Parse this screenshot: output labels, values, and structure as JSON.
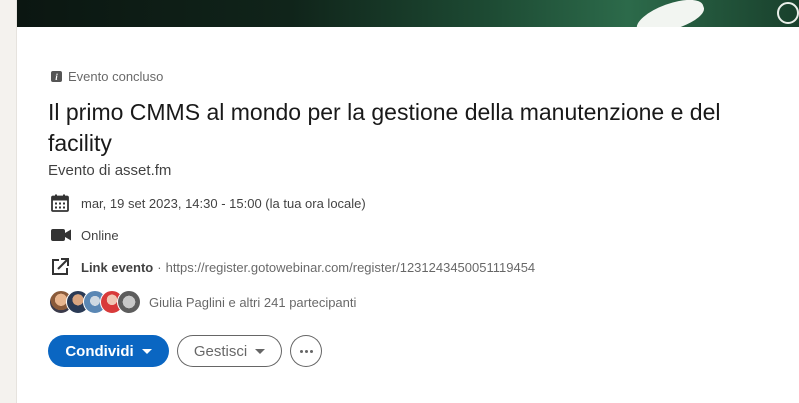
{
  "event": {
    "status": "Evento concluso",
    "title": "Il primo CMMS al mondo per la gestione della manutenzione e del facility",
    "organizer_prefix": "Evento di",
    "organizer_name": "asset.fm",
    "date": "mar, 19 set 2023, 14:30 - 15:00 (la tua ora locale)",
    "location": "Online",
    "link_label": "Link evento",
    "link_separator": "·",
    "link_url": "https://register.gotowebinar.com/register/1231243450051119454",
    "attendees_text": "Giulia Paglini e altri 241 partecipanti"
  },
  "actions": {
    "share_label": "Condividi",
    "manage_label": "Gestisci"
  },
  "icons": {
    "status": "info-icon",
    "date": "calendar-icon",
    "location": "video-camera-icon",
    "link": "external-link-icon",
    "more": "more-horizontal-icon"
  },
  "colors": {
    "primary": "#0a66c2",
    "background": "#f4f2ee"
  }
}
